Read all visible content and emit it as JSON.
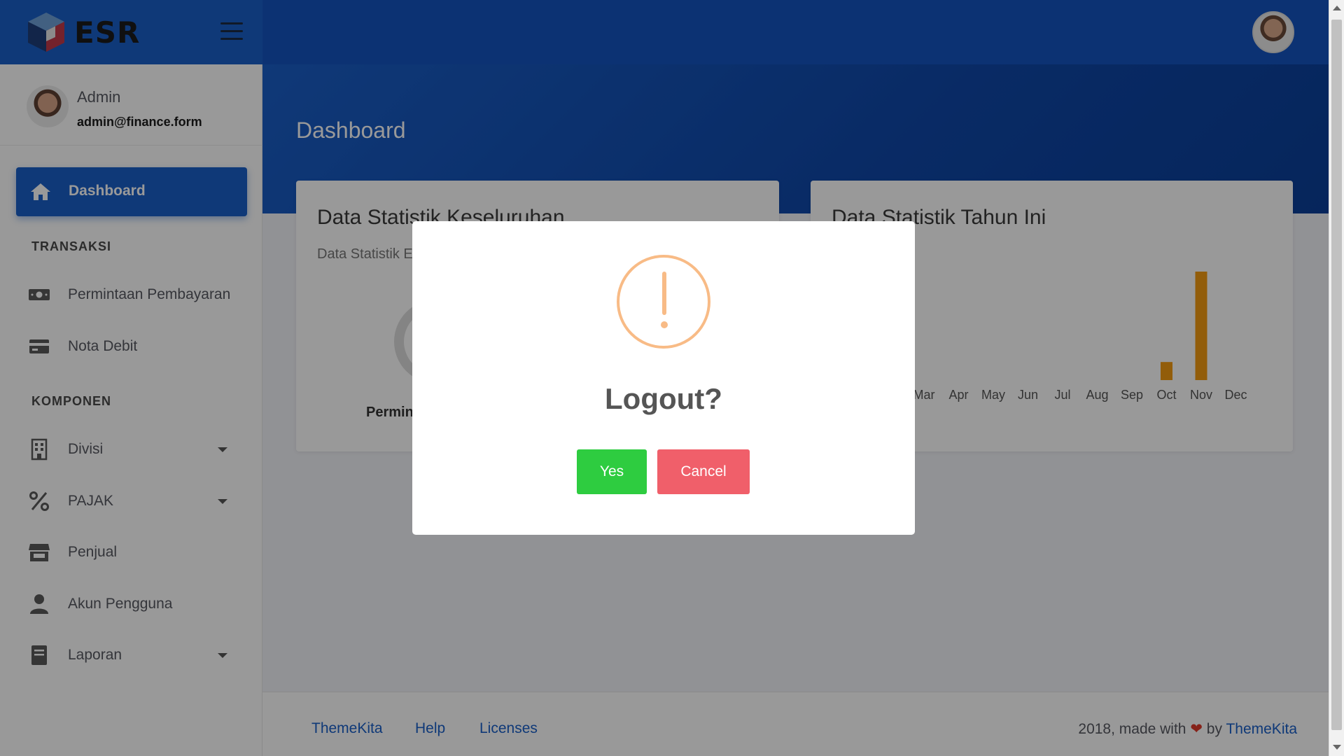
{
  "header": {
    "logo_text": "ESR",
    "logo_icon": "cube-logo",
    "menu_icon": "hamburger-icon"
  },
  "sidebar": {
    "user": {
      "name": "Admin",
      "email": "admin@finance.form"
    },
    "active_item": {
      "label": "Dashboard",
      "icon": "home-icon"
    },
    "sections": [
      {
        "title": "TRANSAKSI"
      },
      {
        "title": "KOMPONEN"
      }
    ],
    "items": [
      {
        "label": "Permintaan Pembayaran",
        "icon": "money-icon",
        "has_dropdown": false
      },
      {
        "label": "Nota Debit",
        "icon": "credit-card-icon",
        "has_dropdown": false
      },
      {
        "label": "Divisi",
        "icon": "building-icon",
        "has_dropdown": true
      },
      {
        "label": "PAJAK",
        "icon": "percent-icon",
        "has_dropdown": true
      },
      {
        "label": "Penjual",
        "icon": "store-icon",
        "has_dropdown": false
      },
      {
        "label": "Akun Pengguna",
        "icon": "user-icon",
        "has_dropdown": false
      },
      {
        "label": "Laporan",
        "icon": "book-icon",
        "has_dropdown": true
      }
    ]
  },
  "main": {
    "page_title": "Dashboard",
    "card_left": {
      "title": "Data Statistik Keseluruhan",
      "subtitle": "Data Statistik E",
      "legend_label": "Permint"
    },
    "card_right": {
      "title": "Data Statistik Tahun Ini"
    }
  },
  "chart_data": {
    "type": "bar",
    "title": "Data Statistik Tahun Ini",
    "categories": [
      "Mar",
      "Apr",
      "May",
      "Jun",
      "Jul",
      "Aug",
      "Sep",
      "Oct",
      "Nov",
      "Dec"
    ],
    "values": [
      0,
      0,
      0,
      0,
      0,
      0,
      0,
      1,
      6,
      0
    ],
    "ylim": [
      0,
      6
    ],
    "color": "#f39c12",
    "grid": false
  },
  "footer": {
    "links": [
      "ThemeKita",
      "Help",
      "Licenses"
    ],
    "copy_prefix": "2018, made with",
    "copy_by": "by",
    "copy_brand": "ThemeKita"
  },
  "modal": {
    "title": "Logout?",
    "icon": "warning-icon",
    "confirm_label": "Yes",
    "cancel_label": "Cancel",
    "confirm_color": "#2ecc40",
    "cancel_color": "#f05f6a"
  }
}
